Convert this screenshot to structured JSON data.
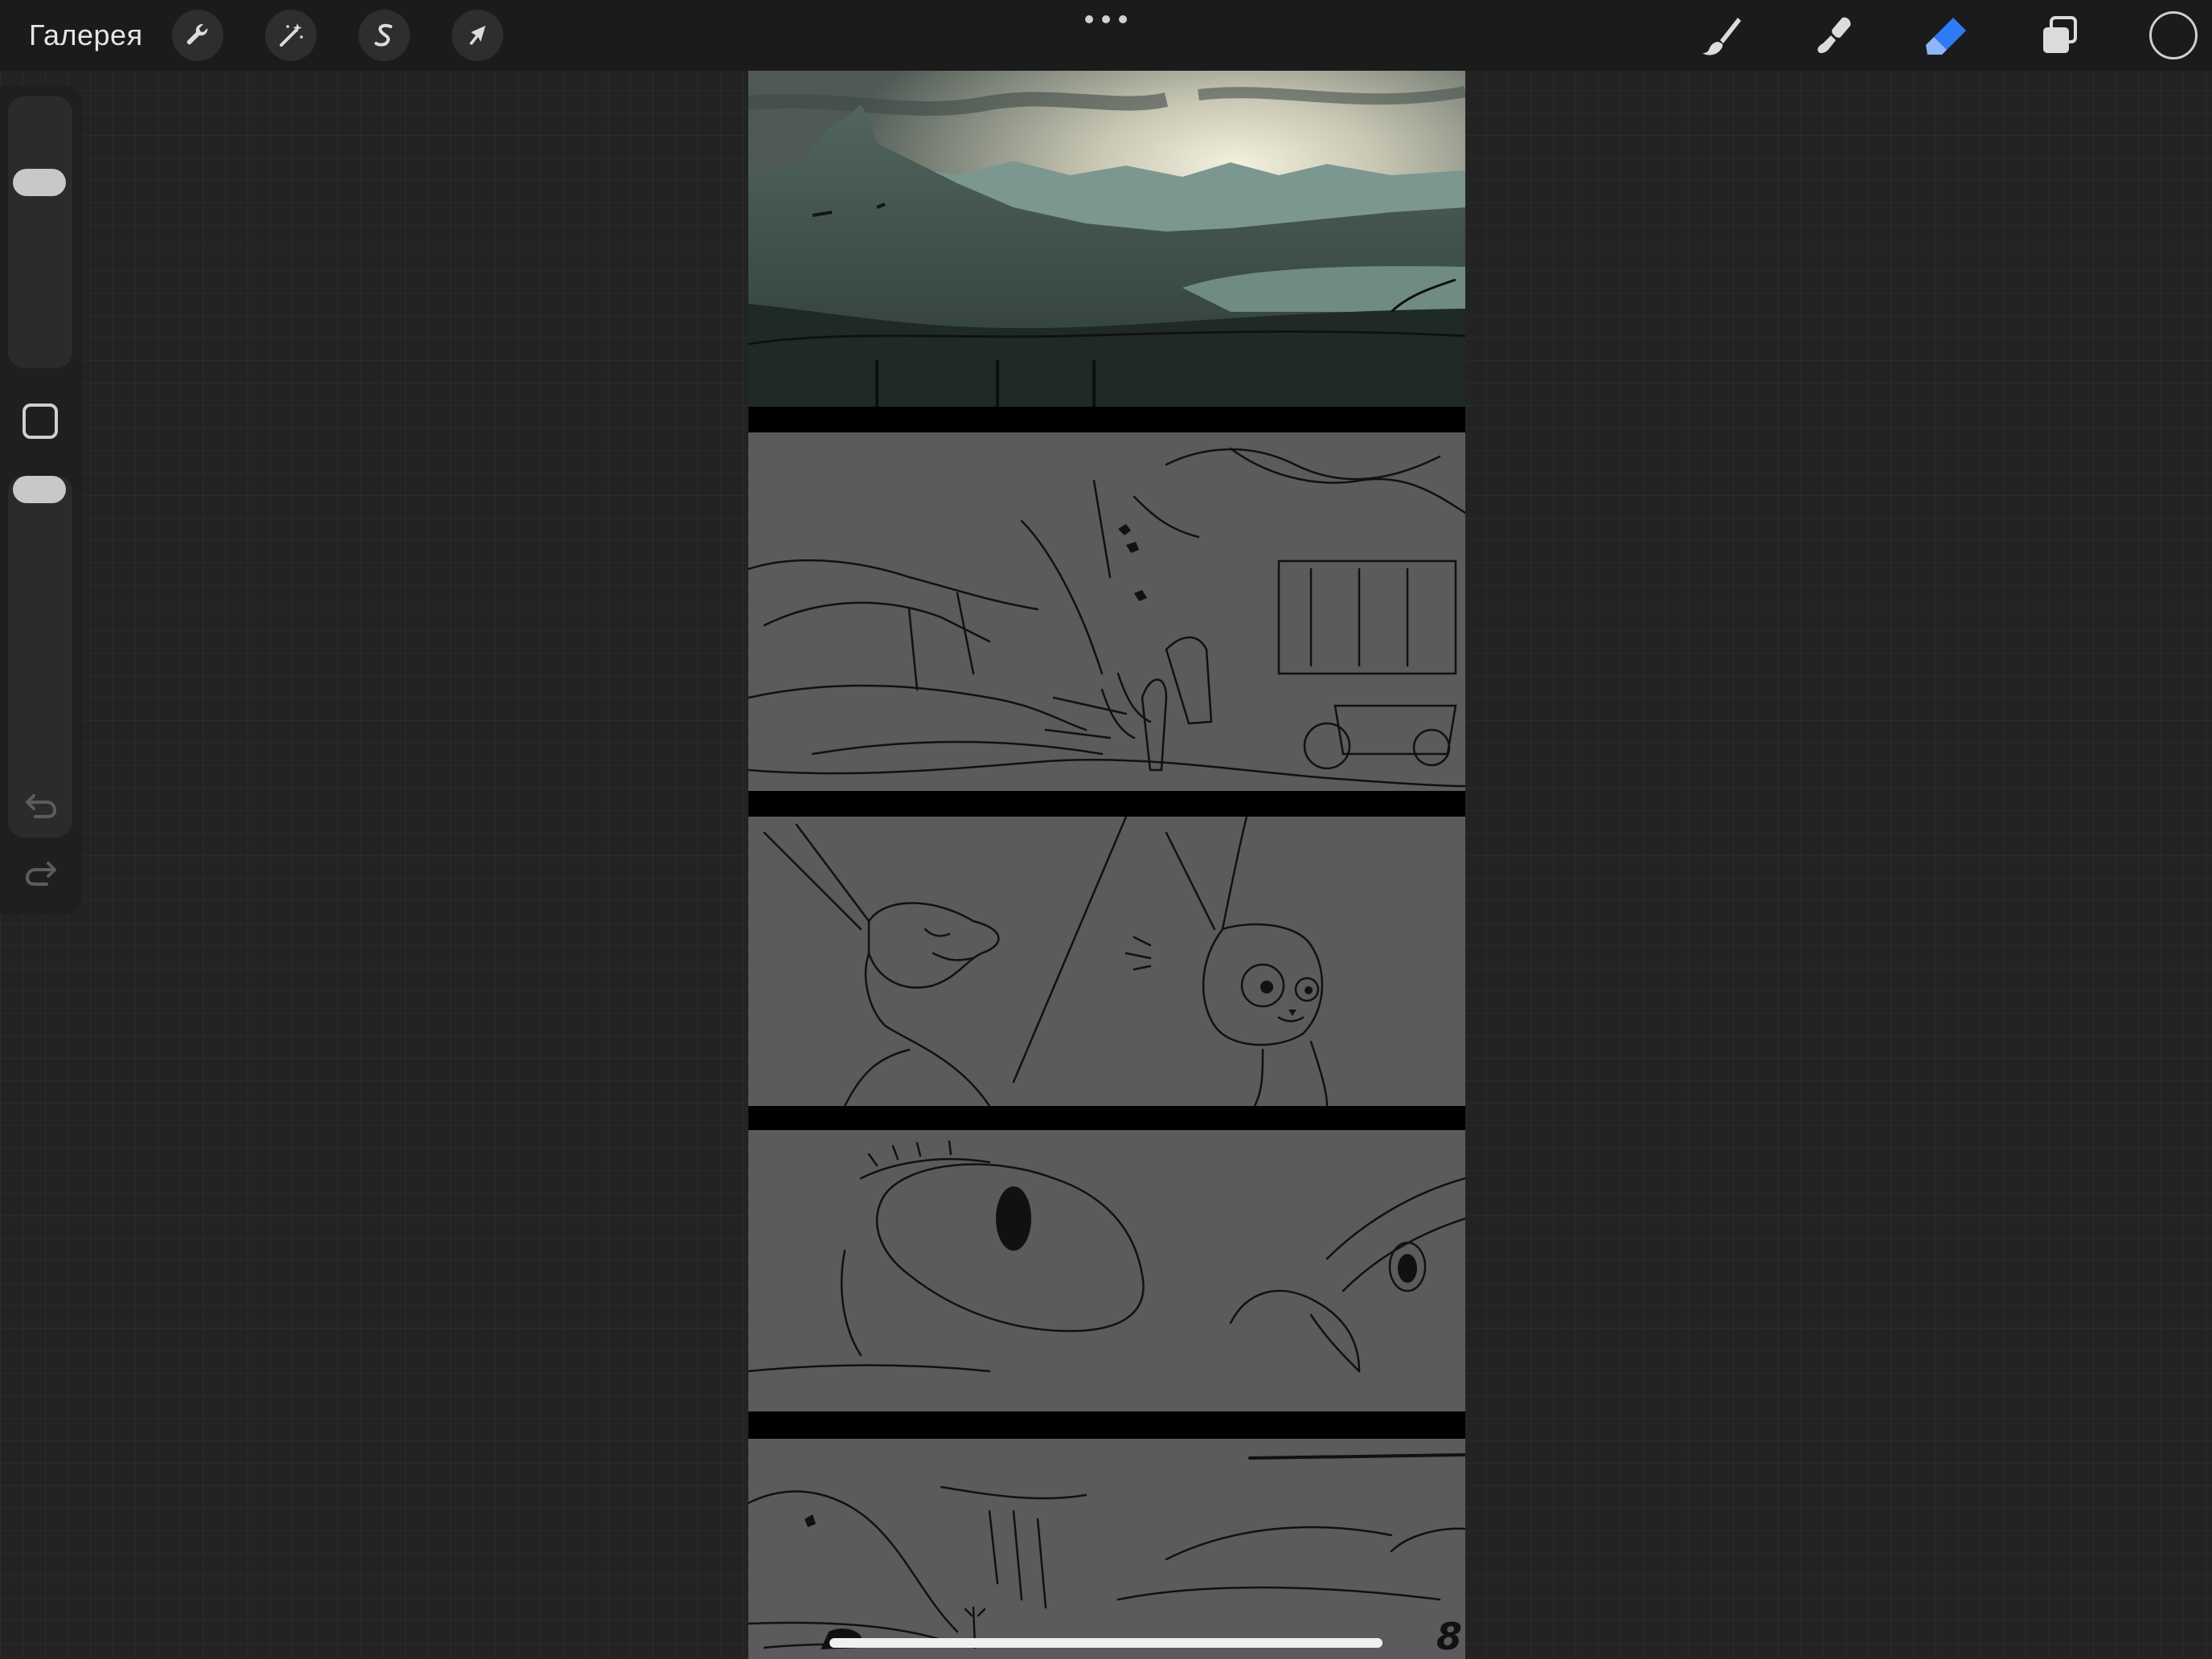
{
  "topbar": {
    "gallery_label": "Галерея",
    "left_tools": [
      {
        "icon": "wrench-icon",
        "name": "actions"
      },
      {
        "icon": "magic-wand-icon",
        "name": "adjustments"
      },
      {
        "icon": "selection-s-icon",
        "name": "selection"
      },
      {
        "icon": "arrow-cursor-icon",
        "name": "transform"
      }
    ],
    "right_tools": [
      {
        "icon": "brush-icon",
        "name": "paint"
      },
      {
        "icon": "smudge-icon",
        "name": "smudge"
      },
      {
        "icon": "eraser-icon",
        "name": "erase",
        "active": true
      },
      {
        "icon": "layers-icon",
        "name": "layers"
      }
    ],
    "active_tool_color": "#2f7bf5",
    "current_color": "#000000"
  },
  "sidebar": {
    "brush_size_icon": "slider-thumb",
    "modifier_icon": "square-icon",
    "opacity_icon": "slider-thumb",
    "undo_icon": "undo-arrow-icon",
    "redo_icon": "redo-arrow-icon"
  },
  "canvas": {
    "page_number": "8",
    "background": "#000000",
    "panel_fill": "#5b5b5e",
    "panels": [
      {
        "name": "mountain-landscape-panel"
      },
      {
        "name": "village-scene-panel"
      },
      {
        "name": "two-rabbits-panel"
      },
      {
        "name": "eye-closeup-panel"
      },
      {
        "name": "waterfall-valley-panel"
      }
    ]
  }
}
